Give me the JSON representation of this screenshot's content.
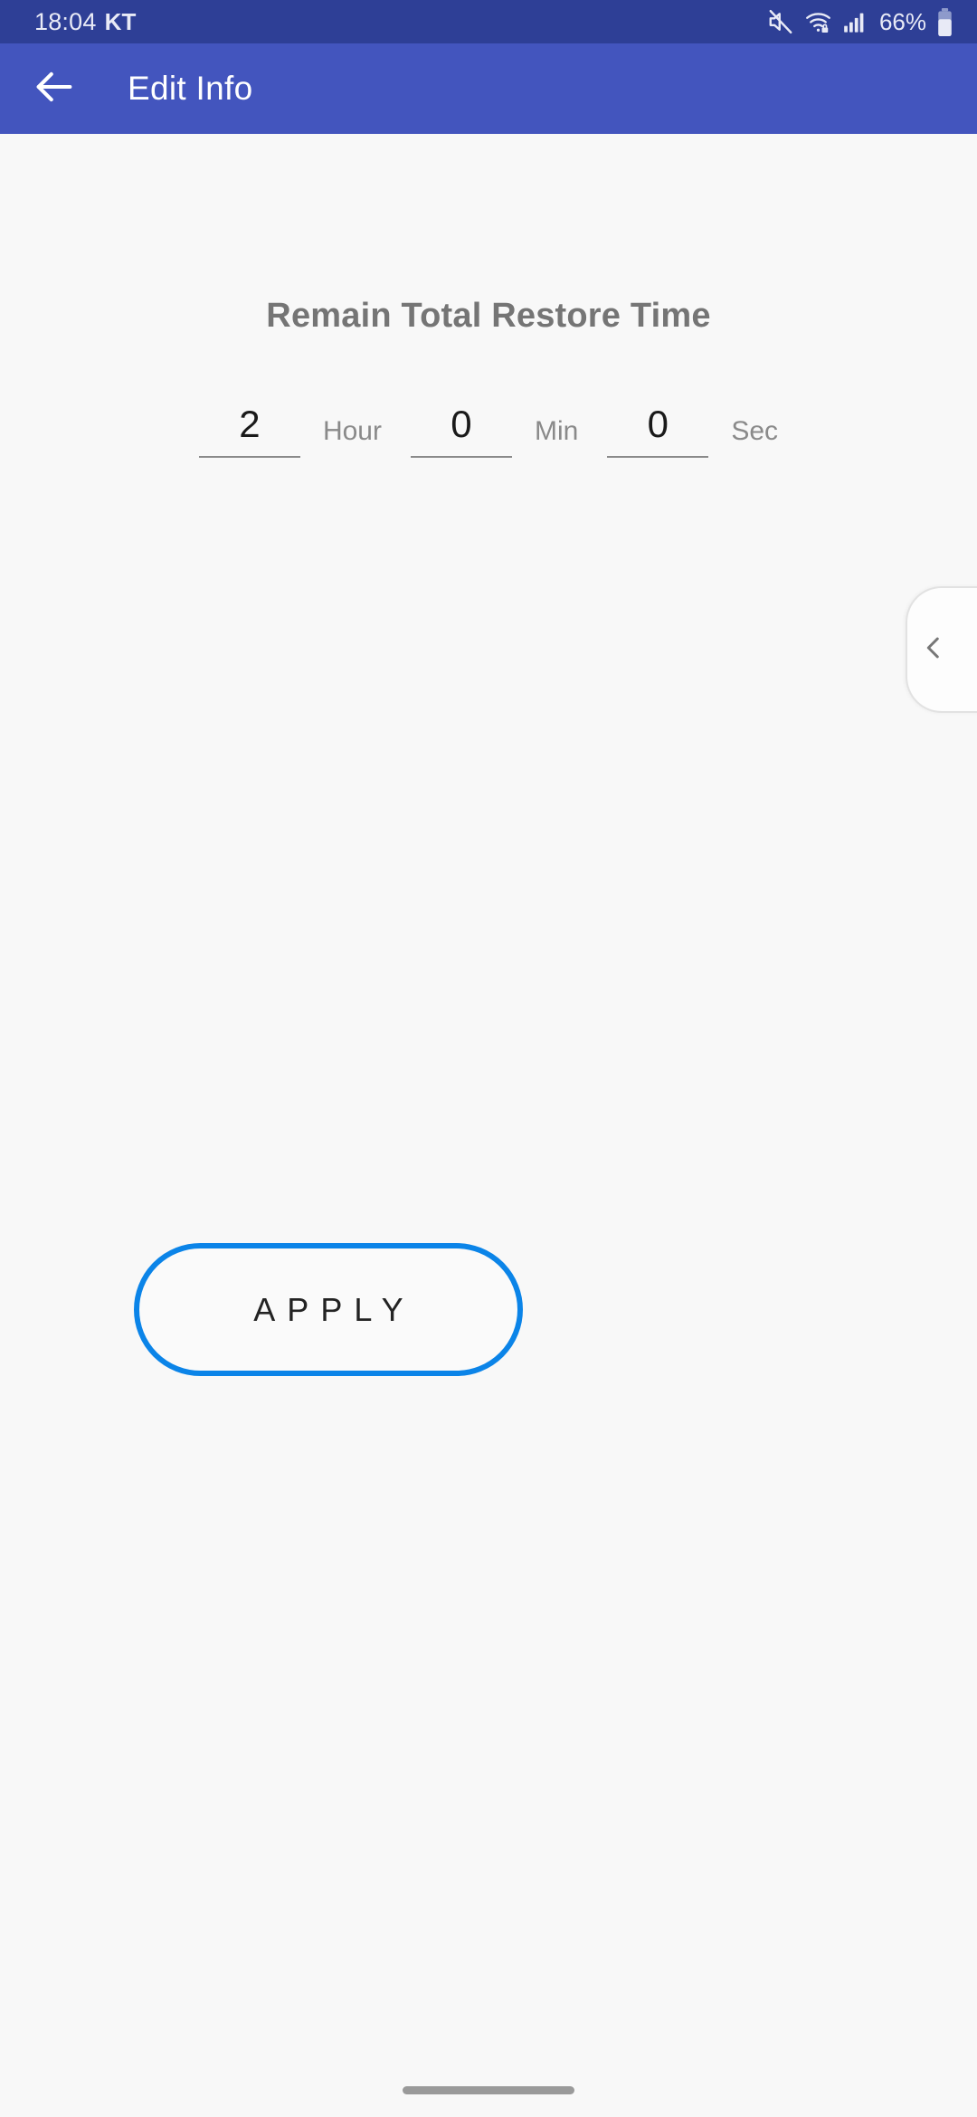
{
  "status_bar": {
    "time": "18:04",
    "carrier": "KT",
    "battery_percent": "66%",
    "icons": [
      "mute-icon",
      "wifi-secured-icon",
      "signal-bars-icon",
      "battery-icon"
    ],
    "background_color": "#2E3F96"
  },
  "app_bar": {
    "title": "Edit Info",
    "back_icon": "back-arrow-icon",
    "background_color": "#4355BE"
  },
  "main": {
    "heading": "Remain Total Restore Time",
    "time_inputs": [
      {
        "value": "2",
        "label": "Hour"
      },
      {
        "value": "0",
        "label": "Min"
      },
      {
        "value": "0",
        "label": "Sec"
      }
    ],
    "apply_label": "APPLY",
    "apply_border_color": "#0B84E8"
  },
  "edge_panel": {
    "icon": "chevron-left-icon"
  },
  "navigation": {
    "home_indicator": "gesture-bar"
  }
}
